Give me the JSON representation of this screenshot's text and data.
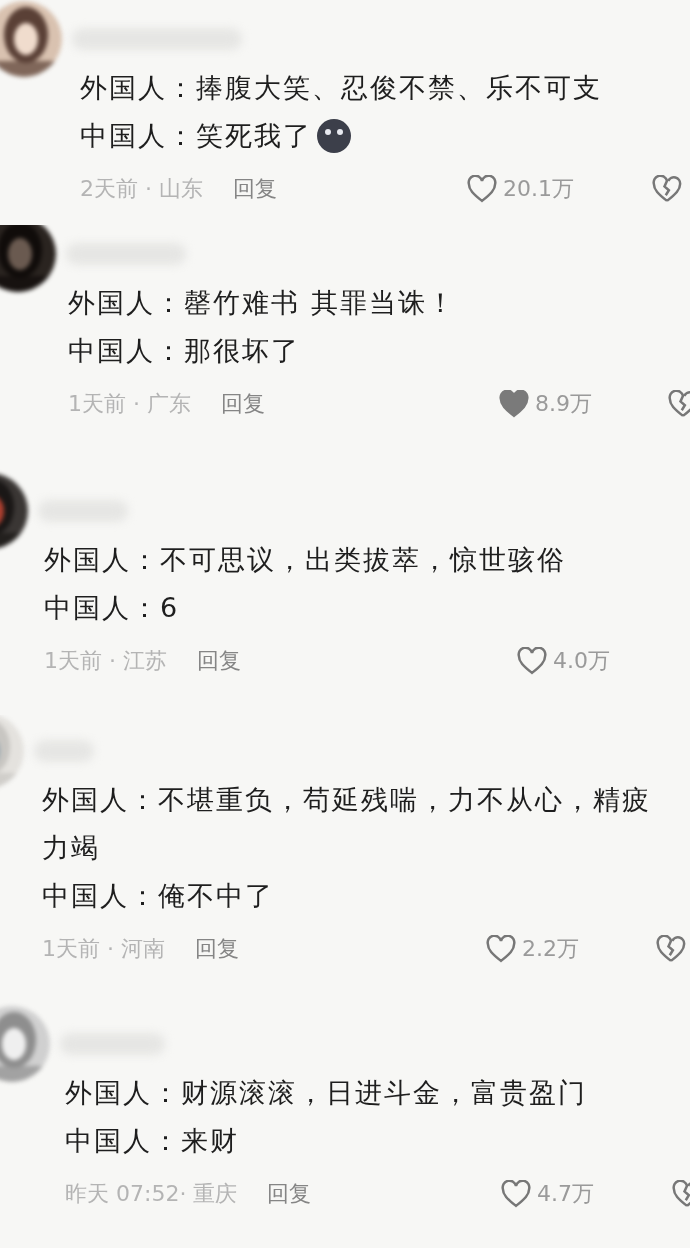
{
  "comments": [
    {
      "lines": [
        "外国人：捧腹大笑、忍俊不禁、乐不可支",
        "中国人：笑死我了"
      ],
      "emoji": true,
      "time": "2天前 · 山东",
      "reply": "回复",
      "likes": "20.1万",
      "liked": false
    },
    {
      "lines": [
        "外国人：罄竹难书 其罪当诛！",
        "中国人：那很坏了"
      ],
      "emoji": false,
      "time": "1天前 · 广东",
      "reply": "回复",
      "likes": "8.9万",
      "liked": true
    },
    {
      "lines": [
        "外国人：不可思议，出类拔萃，惊世骇俗",
        "中国人：6"
      ],
      "emoji": false,
      "time": "1天前 · 江苏",
      "reply": "回复",
      "likes": "4.0万",
      "liked": false
    },
    {
      "lines": [
        "外国人：不堪重负，苟延残喘，力不从心，精疲力竭",
        "中国人：俺不中了"
      ],
      "emoji": false,
      "time": "1天前 · 河南",
      "reply": "回复",
      "likes": "2.2万",
      "liked": false
    },
    {
      "lines": [
        "外国人：财源滚滚，日进斗金，富贵盈门",
        "中国人：来财"
      ],
      "emoji": false,
      "time": "昨天 07:52· 重庆",
      "reply": "回复",
      "likes": "4.7万",
      "liked": false
    }
  ]
}
